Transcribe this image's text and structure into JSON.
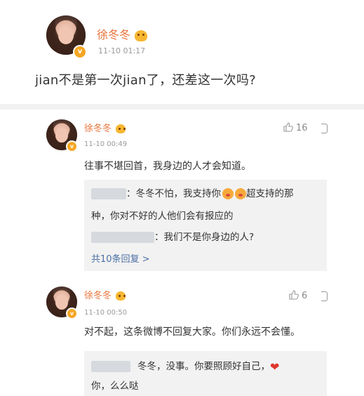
{
  "post": {
    "author": "徐冬冬",
    "time": "11-10 01:17",
    "text": "jian不是第一次jian了，还差这一次吗?"
  },
  "comments": [
    {
      "author": "徐冬冬",
      "time": "11-10 00:49",
      "likes": "16",
      "text": "往事不堪回首，我身边的人才会知道。",
      "reply1_part1": "：冬冬不怕，我支持你",
      "reply1_part2": "超支持的那",
      "reply1_line2": "种，你对不好的人他们会有报应的",
      "reply2": "：我们不是你身边的人?",
      "more": "共10条回复 >"
    },
    {
      "author": "徐冬冬",
      "time": "11-10 00:50",
      "likes": "6",
      "text": "对不起，这条微博不回复大家。你们永远不会懂。",
      "reply1_part1": "冬冬，没事。你要照顾好自己，",
      "reply1_line2": "你，么么哒"
    }
  ],
  "colors": {
    "name": "#e8743b",
    "link": "#4a6fa5",
    "verified": "#f5a623"
  }
}
